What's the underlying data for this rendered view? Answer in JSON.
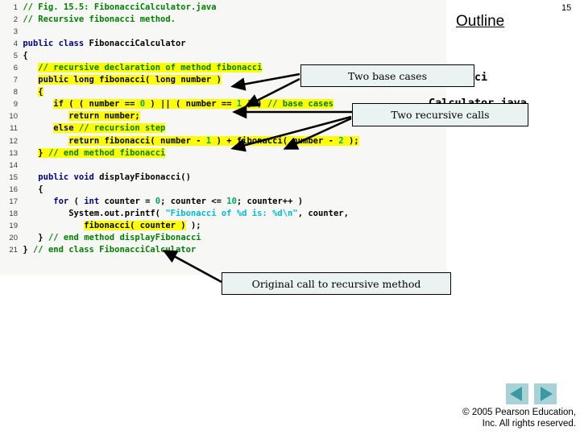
{
  "slide": {
    "page_number": "15",
    "outline_heading": "Outline",
    "outline_entries": [
      "Fibonacci",
      "Calculator.java"
    ]
  },
  "code": {
    "language": "java",
    "lines": [
      {
        "n": "1",
        "html": "<span class=\"cm\">// Fig. 15.5: FibonacciCalculator.java</span>"
      },
      {
        "n": "2",
        "html": "<span class=\"cm\">// Recursive fibonacci method.</span>"
      },
      {
        "n": "3",
        "html": ""
      },
      {
        "n": "4",
        "html": "<span class=\"kw\">public class </span><span class=\"pl\">FibonacciCalculator</span>"
      },
      {
        "n": "5",
        "html": "<span class=\"pl\">{</span>"
      },
      {
        "n": "6",
        "html": "   <span class=\"hl cm\">// recursive declaration of method fibonacci</span>"
      },
      {
        "n": "7",
        "html": "   <span class=\"hl\"><span class=\"kw\">public long </span><span class=\"pl\">fibonacci( </span><span class=\"kw\">long </span><span class=\"pl\">number )</span></span>"
      },
      {
        "n": "8",
        "html": "   <span class=\"hl pl\">{</span>"
      },
      {
        "n": "9",
        "html": "      <span class=\"hl\"><span class=\"kw\">if </span><span class=\"pl\">( ( number == </span><span class=\"num\">0</span><span class=\"pl\"> ) || ( number == </span><span class=\"num\">1</span><span class=\"pl\"> ) ) </span><span class=\"cm\">// base cases</span></span>"
      },
      {
        "n": "10",
        "html": "         <span class=\"hl\"><span class=\"kw\">return </span><span class=\"pl\">number;</span></span>"
      },
      {
        "n": "11",
        "html": "      <span class=\"hl\"><span class=\"kw\">else </span><span class=\"cm\">// recursion step</span></span>"
      },
      {
        "n": "12",
        "html": "         <span class=\"hl\"><span class=\"kw\">return </span><span class=\"pl\">fibonacci( number - </span><span class=\"num\">1</span><span class=\"pl\"> ) + fibonacci( number - </span><span class=\"num\">2</span><span class=\"pl\"> );</span></span>"
      },
      {
        "n": "13",
        "html": "   <span class=\"hl\"><span class=\"pl\">} </span><span class=\"cm\">// end method fibonacci</span></span>"
      },
      {
        "n": "14",
        "html": ""
      },
      {
        "n": "15",
        "html": "   <span class=\"kw\">public void </span><span class=\"pl\">displayFibonacci()</span>"
      },
      {
        "n": "16",
        "html": "   <span class=\"pl\">{</span>"
      },
      {
        "n": "17",
        "html": "      <span class=\"kw\">for </span><span class=\"pl\">( </span><span class=\"kw\">int </span><span class=\"pl\">counter = </span><span class=\"num\">0</span><span class=\"pl\">; counter &lt;= </span><span class=\"num\">10</span><span class=\"pl\">; counter++ )</span>"
      },
      {
        "n": "18",
        "html": "         <span class=\"pl\">System.out.printf( </span><span class=\"str\">\"Fibonacci of %d is: %d\\n\"</span><span class=\"pl\">, counter,</span>"
      },
      {
        "n": "19",
        "html": "            <span class=\"hl pl\">fibonacci( counter )</span><span class=\"pl\"> );</span>"
      },
      {
        "n": "20",
        "html": "   <span class=\"pl\">} </span><span class=\"cm\">// end method displayFibonacci</span>"
      },
      {
        "n": "21",
        "html": "<span class=\"pl\">} </span><span class=\"cm\">// end class FibonacciCalculator</span>"
      }
    ]
  },
  "callouts": [
    {
      "id": "base-cases",
      "label": "Two base cases"
    },
    {
      "id": "recursive-calls",
      "label": "Two recursive calls"
    },
    {
      "id": "original-call",
      "label": "Original call to recursive method"
    }
  ],
  "footer": {
    "copyright_line_1": "© 2005 Pearson Education,",
    "copyright_line_2": "Inc.  All rights reserved.",
    "prev_label": "Previous slide",
    "next_label": "Next slide"
  },
  "colors": {
    "highlight": "#ffff00",
    "keyword": "#00008b",
    "comment": "#008000",
    "callout_bg": "#eaf3f1",
    "nav_button_bg": "#a8d3d6",
    "nav_arrow": "#3a9aa3",
    "code_panel_bg": "#f7f7f5"
  }
}
